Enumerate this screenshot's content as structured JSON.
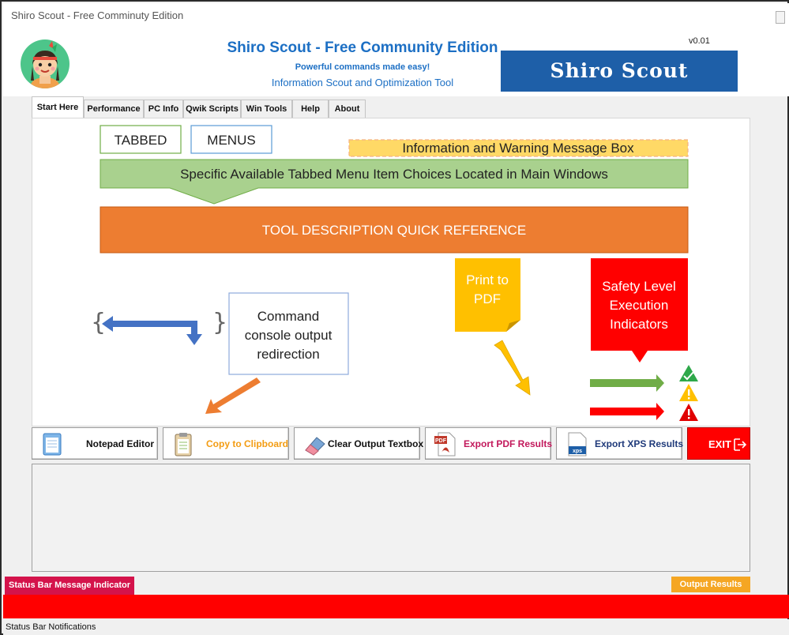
{
  "window": {
    "title": "Shiro Scout - Free Comminuty Edition"
  },
  "header": {
    "app_title": "Shiro Scout - Free Community Edition",
    "tagline": "Powerful commands made easy!",
    "subtitle": "Information Scout and Optimization Tool",
    "version": "v0.01",
    "logo_text": "Shiro Scout"
  },
  "tabs": [
    {
      "label": "Start Here",
      "active": true
    },
    {
      "label": "Performance"
    },
    {
      "label": "PC Info"
    },
    {
      "label": "Qwik Scripts"
    },
    {
      "label": "Win Tools"
    },
    {
      "label": "Help"
    },
    {
      "label": "About"
    }
  ],
  "diagram": {
    "tabbed_label": "TABBED",
    "menus_label": "MENUS",
    "message_box": "Information and Warning Message Box",
    "menu_items_banner": "Specific Available Tabbed Menu Item Choices Located in Main Windows",
    "tool_description": "TOOL DESCRIPTION QUICK REFERENCE",
    "console_redirect": [
      "Command",
      "console output",
      "redirection"
    ],
    "print_pdf": [
      "Print to",
      "PDF"
    ],
    "safety_level": [
      "Safety Level",
      "Execution",
      "Indicators"
    ]
  },
  "toolbar": {
    "notepad": "Notepad Editor",
    "copy": "Copy to Clipboard",
    "clear": "Clear Output Textbox",
    "pdf": "Export PDF Results",
    "xps": "Export XPS Results",
    "exit": "EXIT",
    "xps_icon_text": "xps",
    "pdf_icon_text": "PDF"
  },
  "status": {
    "indicator": "Status Bar Message Indicator",
    "output_results": "Output Results",
    "notifications": "Status Bar Notifications"
  },
  "colors": {
    "accent_blue": "#1c6fc4",
    "green": "#70ad47",
    "orange": "#ed7d31",
    "yellow": "#ffc000",
    "red": "#ff0000",
    "status_pink": "#d4134b"
  },
  "icons": [
    "mascot-avatar",
    "notepad-icon",
    "clipboard-icon",
    "eraser-icon",
    "pdf-icon",
    "xps-icon",
    "exit-icon",
    "check-icon",
    "warning-icon",
    "danger-icon"
  ]
}
